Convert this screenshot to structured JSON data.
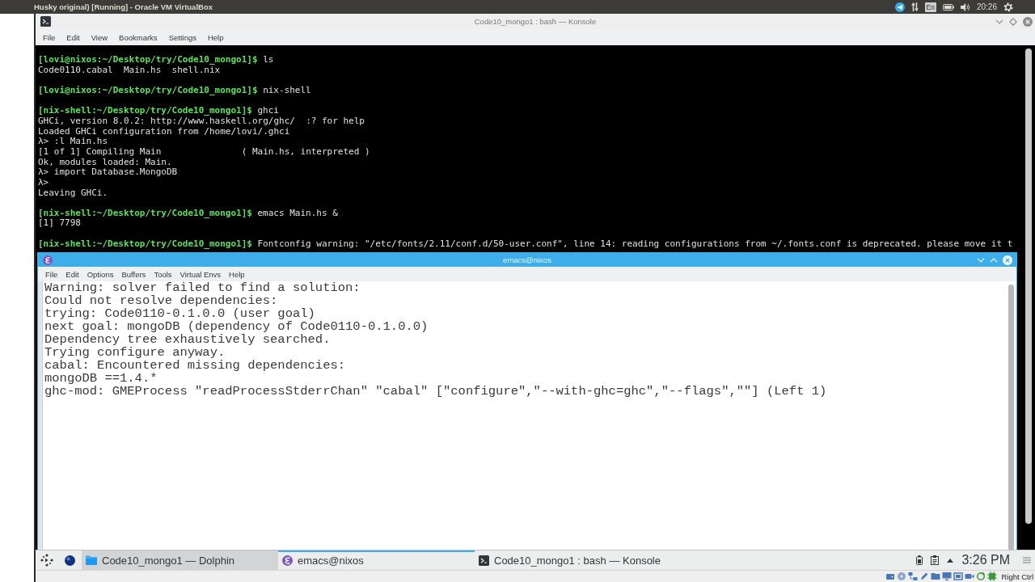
{
  "host_bar": {
    "title": "Husky original) [Running] - Oracle VM VirtualBox",
    "keyboard_layout": "En",
    "clock": "20:26"
  },
  "konsole": {
    "title": "Code10_mongo1 : bash — Konsole",
    "menu": [
      "File",
      "Edit",
      "View",
      "Bookmarks",
      "Settings",
      "Help"
    ],
    "blocks": [
      [
        {
          "kind": "prompt",
          "prompt": "[lovi@nixos:~/Desktop/try/Code10_mongo1]$",
          "text": "ls"
        },
        {
          "kind": "output",
          "text": "Code0110.cabal  Main.hs  shell.nix"
        }
      ],
      [
        {
          "kind": "prompt",
          "prompt": "[lovi@nixos:~/Desktop/try/Code10_mongo1]$",
          "text": "nix-shell"
        }
      ],
      [
        {
          "kind": "prompt",
          "prompt": "[nix-shell:~/Desktop/try/Code10_mongo1]$",
          "text": "ghci"
        },
        {
          "kind": "output",
          "text": "GHCi, version 8.0.2: http://www.haskell.org/ghc/  :? for help"
        },
        {
          "kind": "output",
          "text": "Loaded GHCi configuration from /home/lovi/.ghci"
        },
        {
          "kind": "output",
          "text": "λ> :l Main.hs"
        },
        {
          "kind": "output",
          "text": "[1 of 1] Compiling Main               ( Main.hs, interpreted )"
        },
        {
          "kind": "output",
          "text": "Ok, modules loaded: Main."
        },
        {
          "kind": "output",
          "text": "λ> import Database.MongoDB"
        },
        {
          "kind": "output",
          "text": "λ>"
        },
        {
          "kind": "output",
          "text": "Leaving GHCi."
        }
      ],
      [
        {
          "kind": "prompt",
          "prompt": "[nix-shell:~/Desktop/try/Code10_mongo1]$",
          "text": "emacs Main.hs &"
        },
        {
          "kind": "output",
          "text": "[1] 7798"
        }
      ],
      [
        {
          "kind": "prompt",
          "prompt": "[nix-shell:~/Desktop/try/Code10_mongo1]$",
          "text": "Fontconfig warning: \"/etc/fonts/2.11/conf.d/50-user.conf\", line 14: reading configurations from ~/.fonts.conf is deprecated. please move it t"
        }
      ]
    ]
  },
  "emacs": {
    "title": "emacs@nixos",
    "menu": [
      "File",
      "Edit",
      "Options",
      "Buffers",
      "Tools",
      "Virtual Envs",
      "Help"
    ],
    "lines": [
      "Warning: solver failed to find a solution:",
      "Could not resolve dependencies:",
      "trying: Code0110-0.1.0.0 (user goal)",
      "next goal: mongoDB (dependency of Code0110-0.1.0.0)",
      "Dependency tree exhaustively searched.",
      "Trying configure anyway.",
      "cabal: Encountered missing dependencies:",
      "mongoDB ==1.4.*",
      "ghc-mod: GMEProcess \"readProcessStderrChan\" \"cabal\" [\"configure\",\"--with-ghc=ghc\",\"--flags\",\"\"] (Left 1)"
    ]
  },
  "taskbar": {
    "tasks": [
      {
        "kind": "folder",
        "label": "Code10_mongo1 — Dolphin",
        "selected": false,
        "highlighted": true
      },
      {
        "kind": "emacs",
        "label": "emacs@nixos",
        "selected": true,
        "highlighted": false
      },
      {
        "kind": "terminal",
        "label": "Code10_mongo1 : bash — Konsole",
        "selected": false,
        "highlighted": false
      }
    ],
    "clock": "3:26 PM"
  },
  "vm_status": {
    "host_key": "Right Ctrl"
  }
}
